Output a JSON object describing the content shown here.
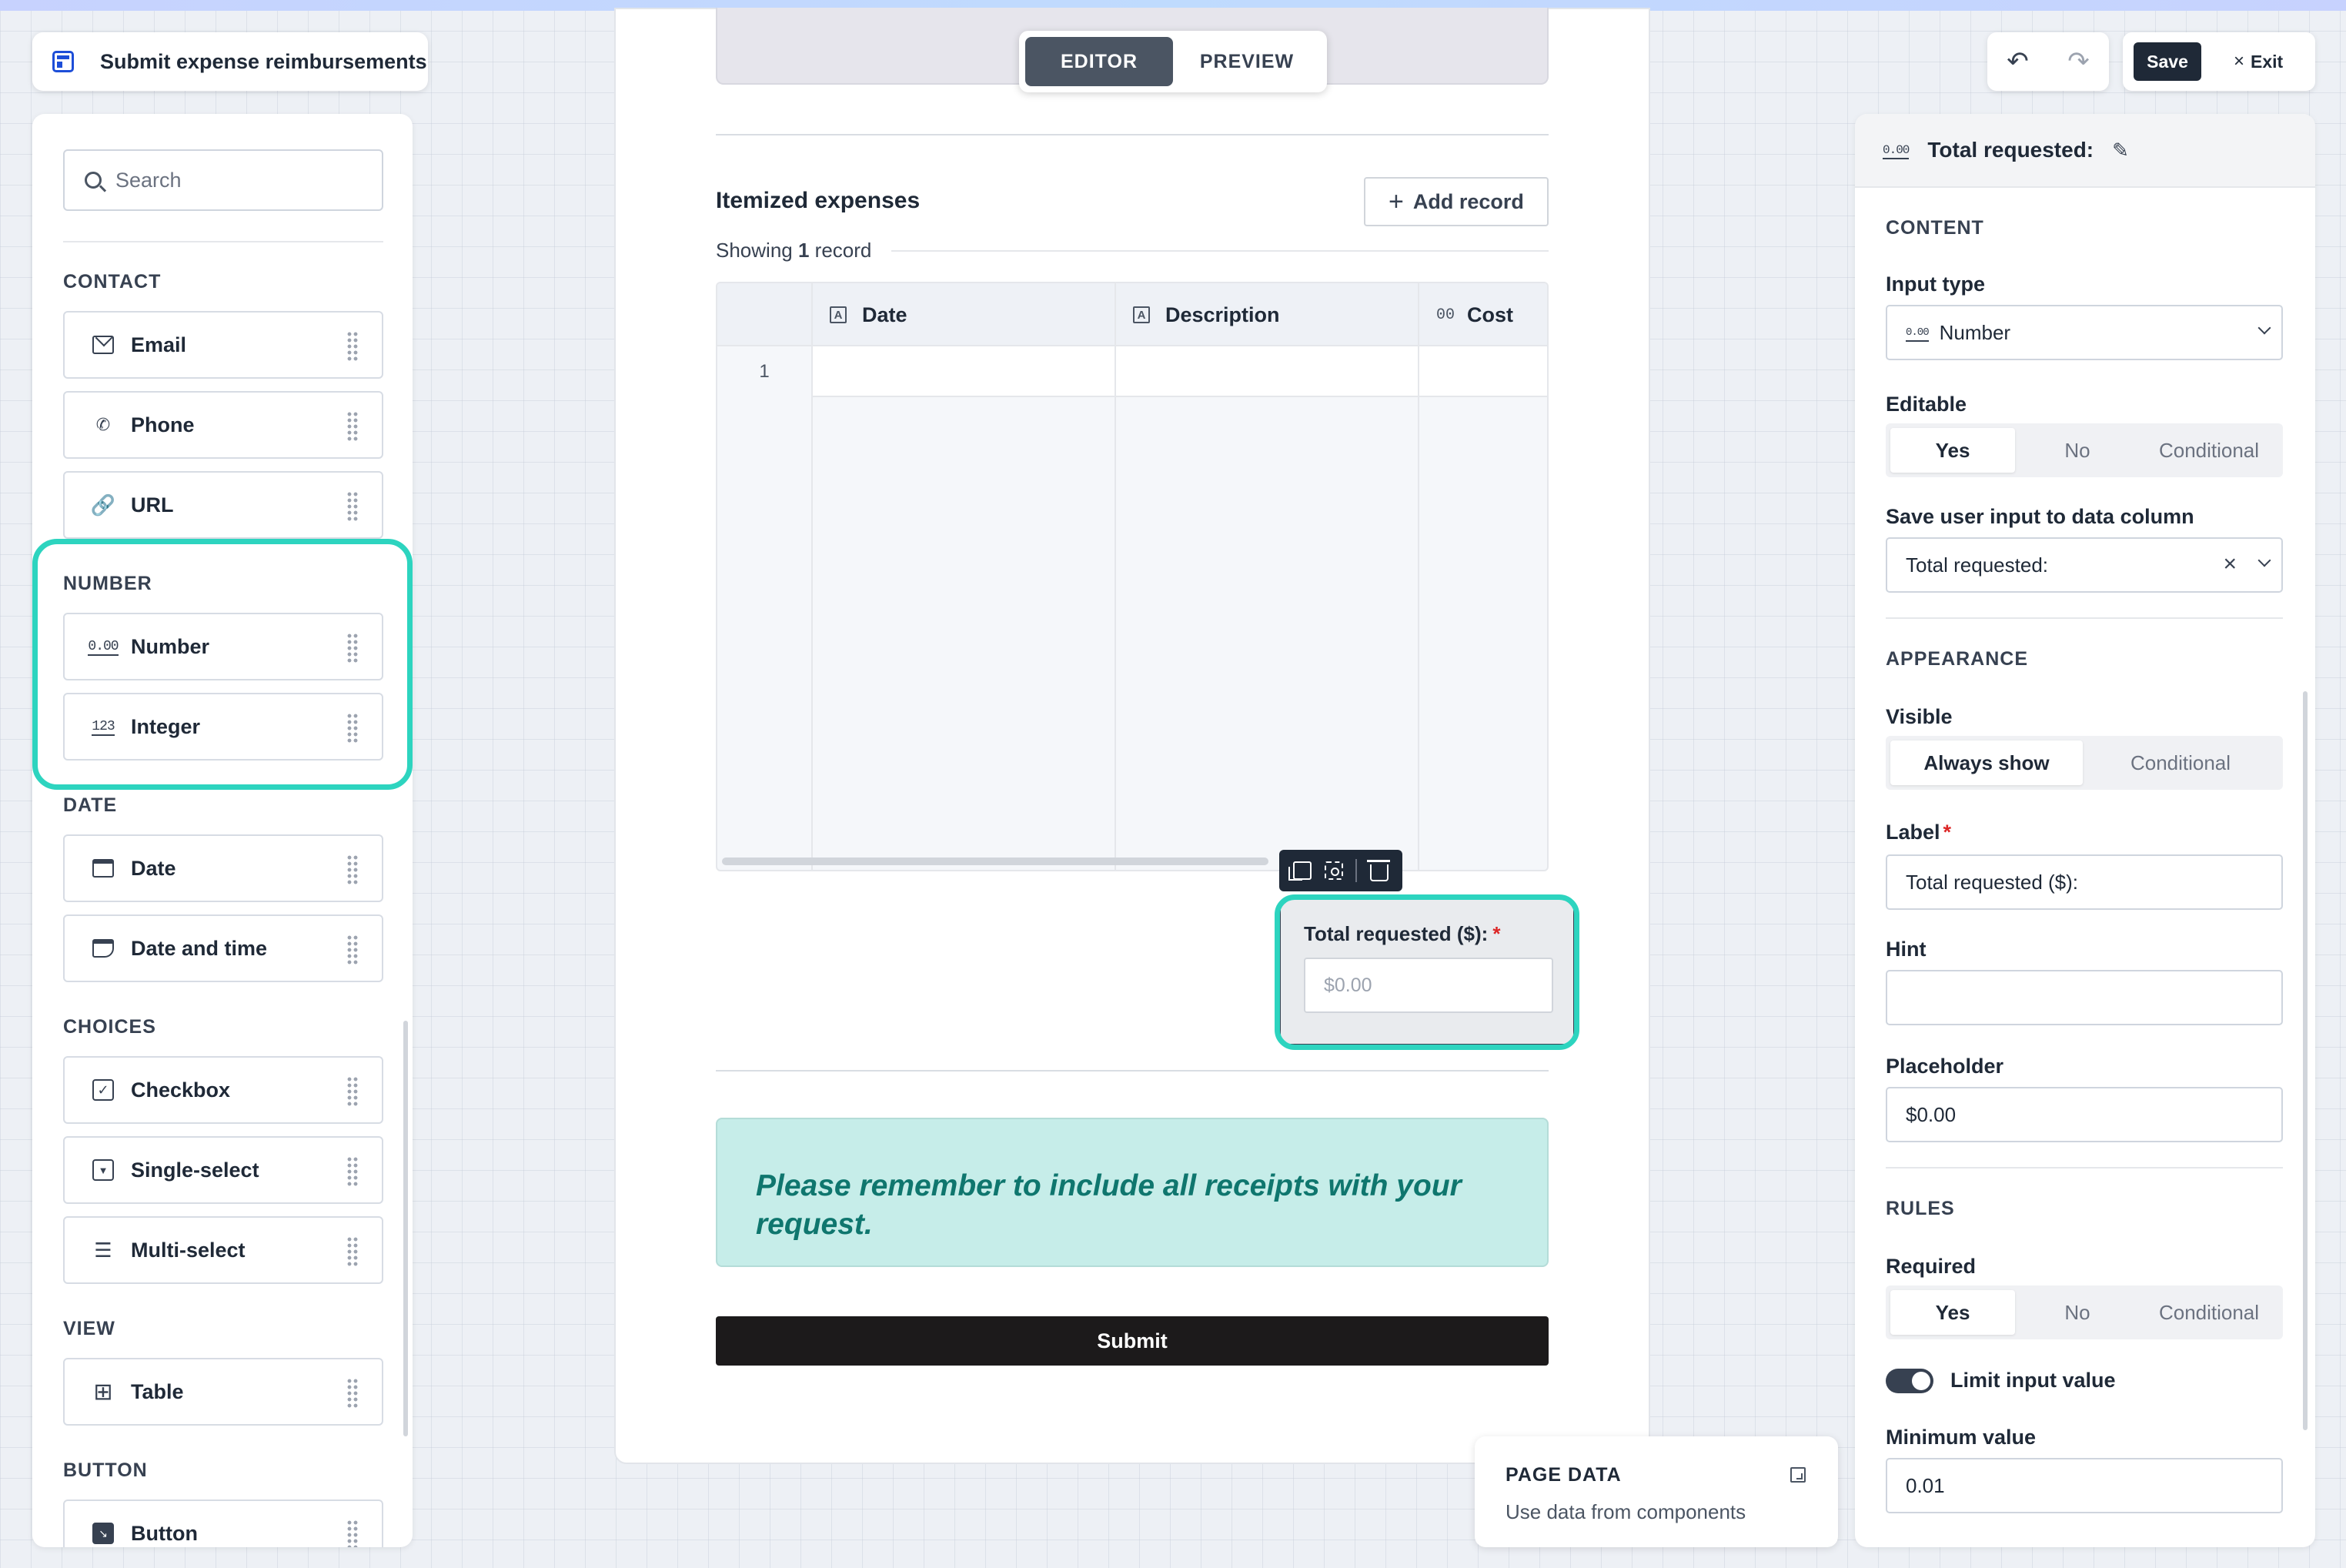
{
  "app": {
    "title": "Submit expense reimbursements"
  },
  "sidebar": {
    "search_placeholder": "Search",
    "sections": [
      {
        "heading": "CONTACT",
        "items": [
          {
            "label": "Email",
            "icon": "envelope-icon"
          },
          {
            "label": "Phone",
            "icon": "phone-icon"
          },
          {
            "label": "URL",
            "icon": "link-icon"
          }
        ]
      },
      {
        "heading": "NUMBER",
        "items": [
          {
            "label": "Number",
            "icon": "decimal-number-icon",
            "icon_text": "0.00"
          },
          {
            "label": "Integer",
            "icon": "integer-icon",
            "icon_text": "123"
          }
        ]
      },
      {
        "heading": "DATE",
        "items": [
          {
            "label": "Date",
            "icon": "calendar-icon"
          },
          {
            "label": "Date and time",
            "icon": "calendar-clock-icon"
          }
        ]
      },
      {
        "heading": "CHOICES",
        "items": [
          {
            "label": "Checkbox",
            "icon": "checkbox-icon"
          },
          {
            "label": "Single-select",
            "icon": "single-select-icon"
          },
          {
            "label": "Multi-select",
            "icon": "multi-select-icon"
          }
        ]
      },
      {
        "heading": "VIEW",
        "items": [
          {
            "label": "Table",
            "icon": "table-icon"
          }
        ]
      },
      {
        "heading": "BUTTON",
        "items": [
          {
            "label": "Button",
            "icon": "button-cursor-icon"
          }
        ]
      }
    ]
  },
  "editor": {
    "modes": [
      "EDITOR",
      "PREVIEW"
    ],
    "active_mode": "EDITOR",
    "itemized": {
      "title": "Itemized expenses",
      "add_record_label": "Add record",
      "showing_prefix": "Showing",
      "showing_count": "1",
      "showing_suffix": "record",
      "columns": [
        {
          "name": "Date",
          "icon": "text-field-icon",
          "icon_text": "A"
        },
        {
          "name": "Description",
          "icon": "text-field-icon",
          "icon_text": "A"
        },
        {
          "name": "Cost",
          "icon": "number-field-icon",
          "icon_text": "00"
        }
      ],
      "row_numbers": [
        "1"
      ]
    },
    "total_field": {
      "label": "Total requested ($):",
      "required_mark": "*",
      "placeholder": "$0.00"
    },
    "notice": "Please remember to include all receipts with your request.",
    "submit_label": "Submit"
  },
  "page_data_panel": {
    "heading": "PAGE DATA",
    "subtitle": "Use data from components"
  },
  "toolbar": {
    "save_label": "Save",
    "exit_label": "Exit"
  },
  "properties": {
    "header_icon_text": "0.00",
    "header_title": "Total requested:",
    "content_heading": "CONTENT",
    "input_type_label": "Input type",
    "input_type_icon_text": "0.00",
    "input_type_value": "Number",
    "editable_label": "Editable",
    "editable_options": [
      "Yes",
      "No",
      "Conditional"
    ],
    "editable_selected": "Yes",
    "save_column_label": "Save user input to data column",
    "save_column_value": "Total requested:",
    "appearance_heading": "APPEARANCE",
    "visible_label": "Visible",
    "visible_options": [
      "Always show",
      "Conditional"
    ],
    "visible_selected": "Always show",
    "label_label": "Label",
    "label_required_mark": "*",
    "label_value": "Total requested ($):",
    "hint_label": "Hint",
    "hint_value": "",
    "placeholder_label": "Placeholder",
    "placeholder_value": "$0.00",
    "rules_heading": "RULES",
    "required_label": "Required",
    "required_options": [
      "Yes",
      "No",
      "Conditional"
    ],
    "required_selected": "Yes",
    "limit_label": "Limit input value",
    "limit_enabled": true,
    "min_label": "Minimum value",
    "min_value": "0.01"
  },
  "colors": {
    "highlight": "#2dd4bf",
    "notice_bg": "#c6ede9",
    "notice_text": "#0f766e",
    "primary_dark": "#1f2937",
    "required": "#dc2626"
  }
}
